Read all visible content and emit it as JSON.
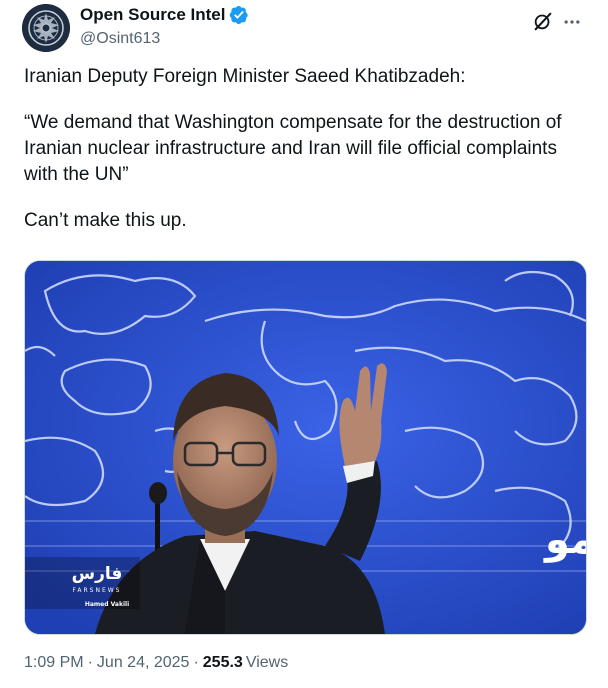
{
  "author": {
    "display_name": "Open Source Intel",
    "handle": "@Osint613",
    "verified": true,
    "verified_color": "#1d9bf0"
  },
  "actions": {
    "grok_icon": "grok-icon",
    "more_icon": "more-icon"
  },
  "tweet": {
    "paragraphs": [
      "Iranian Deputy Foreign Minister Saeed Khatibzadeh:",
      "“We demand that Washington compensate for the destruction of Iranian nuclear infrastructure and Iran will file official complaints with the UN”",
      "Can’t make this up."
    ]
  },
  "media": {
    "watermark_brand": "فارس",
    "watermark_sub": "FARSNEWS",
    "photographer": "Hamed Vakili",
    "backdrop_text": "وزارت امو",
    "background_color": "#2a4fd0"
  },
  "meta": {
    "time": "1:09 PM",
    "date": "Jun 24, 2025",
    "views_count": "255.3",
    "views_label": "Views",
    "separator": "·"
  }
}
